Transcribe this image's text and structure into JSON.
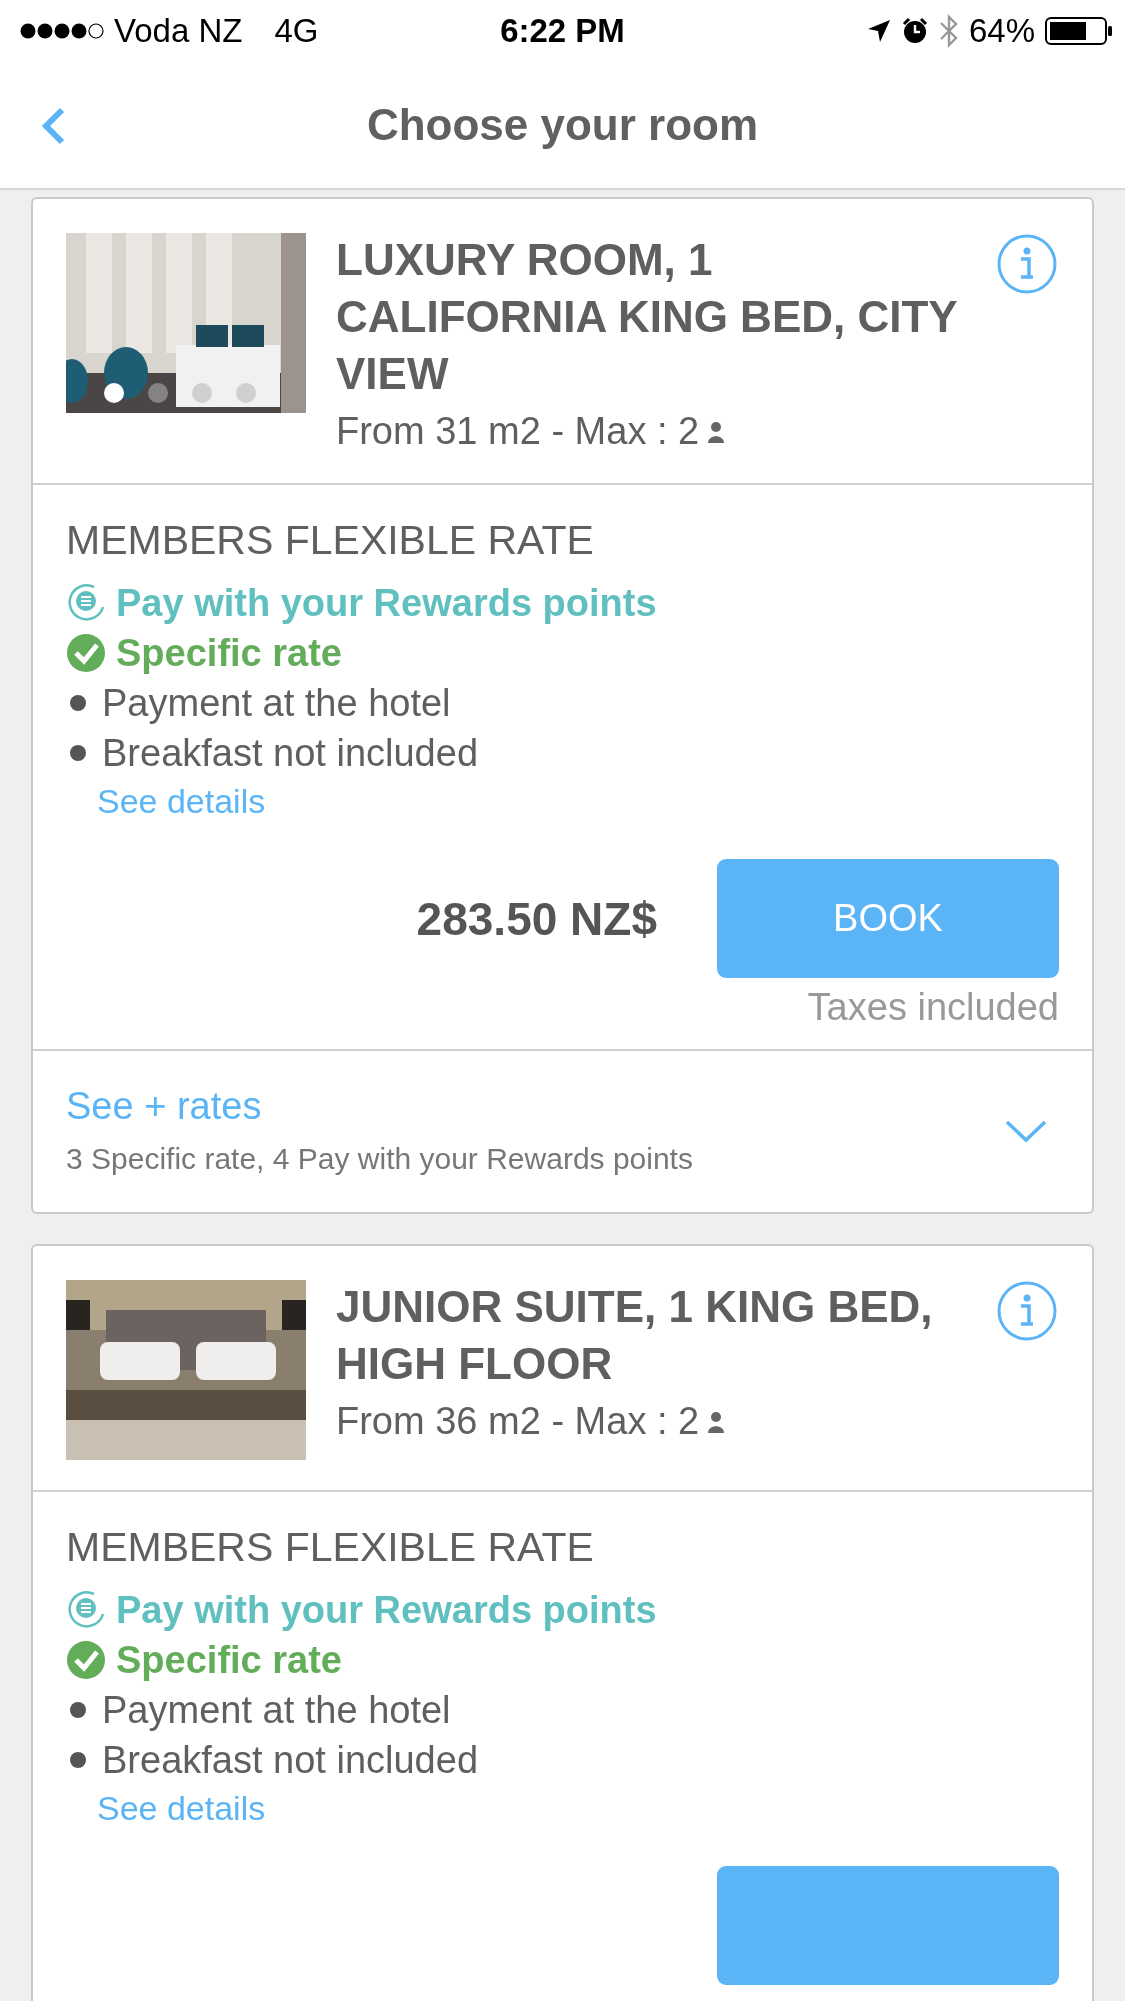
{
  "status_bar": {
    "carrier": "Voda NZ",
    "network": "4G",
    "time": "6:22 PM",
    "battery": "64%"
  },
  "nav": {
    "title": "Choose your room"
  },
  "rooms": [
    {
      "title": "LUXURY ROOM, 1 CALIFORNIA KING BED, CITY VIEW",
      "size": "From 31 m2 - Max : 2",
      "photo_dots": [
        {
          "selected": true
        },
        {
          "selected": false
        },
        {
          "selected": false
        },
        {
          "selected": false
        }
      ],
      "rate": {
        "name": "MEMBERS FLEXIBLE RATE",
        "lines": [
          {
            "kind": "rewards",
            "text": "Pay with your Rewards points"
          },
          {
            "kind": "specific",
            "text": "Specific rate"
          },
          {
            "kind": "bullet",
            "text": "Payment at the hotel"
          },
          {
            "kind": "bullet",
            "text": "Breakfast not included"
          }
        ],
        "details_link": "See details",
        "price": "283.50 NZ$",
        "book": "BOOK",
        "taxes": "Taxes included"
      },
      "more_rates": {
        "link": "See + rates",
        "summary": "3 Specific rate, 4 Pay with your Rewards points"
      }
    },
    {
      "title": "JUNIOR SUITE, 1 KING BED, HIGH FLOOR",
      "size": "From 36 m2 - Max : 2",
      "rate": {
        "name": "MEMBERS FLEXIBLE RATE",
        "lines": [
          {
            "kind": "rewards",
            "text": "Pay with your Rewards points"
          },
          {
            "kind": "specific",
            "text": "Specific rate"
          },
          {
            "kind": "bullet",
            "text": "Payment at the hotel"
          },
          {
            "kind": "bullet",
            "text": "Breakfast not included"
          }
        ],
        "details_link": "See details"
      }
    }
  ]
}
